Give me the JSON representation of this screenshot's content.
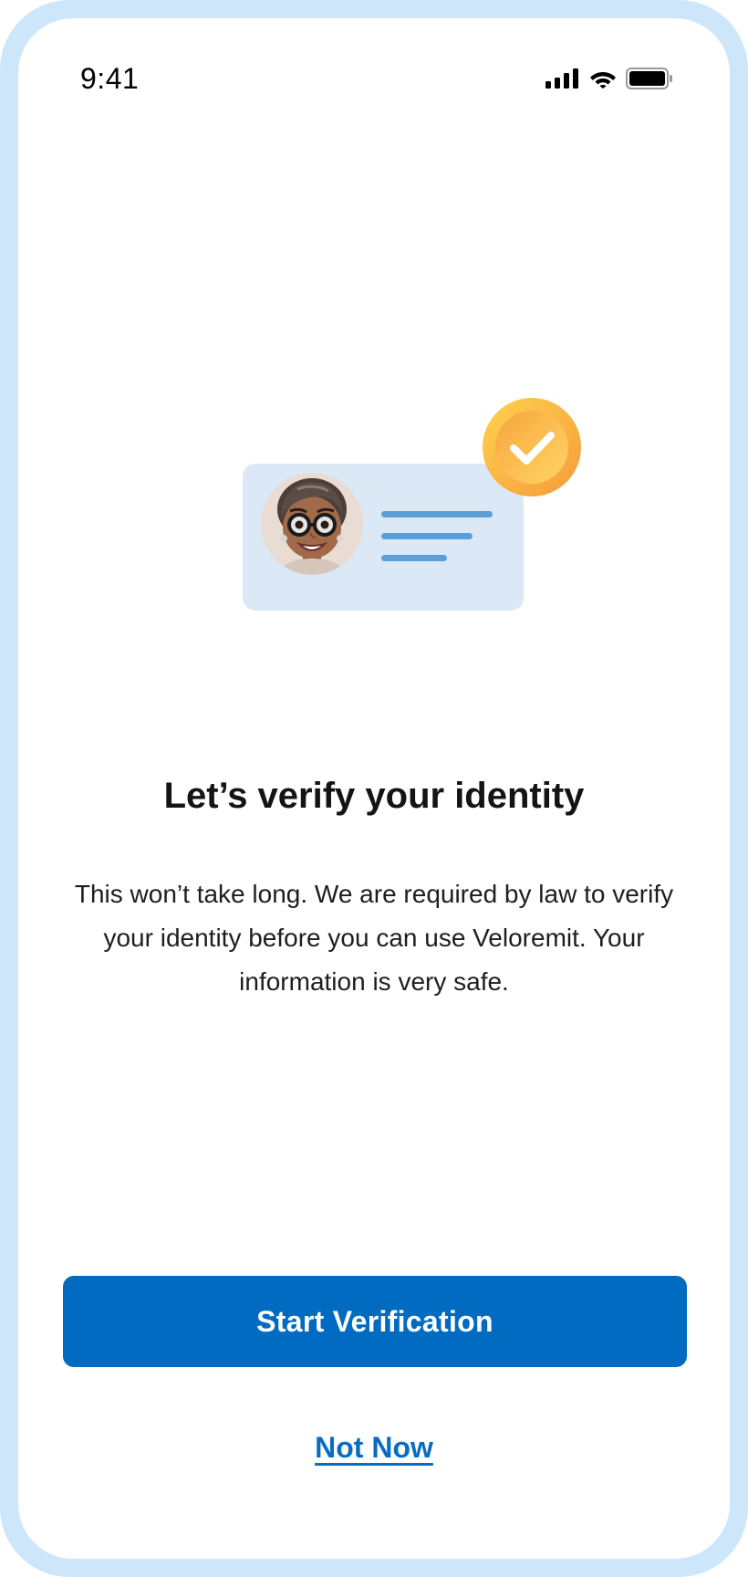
{
  "status_bar": {
    "time": "9:41",
    "icons": [
      "cellular-signal-icon",
      "wifi-icon",
      "battery-icon"
    ]
  },
  "illustration": {
    "elements": [
      "id-card-icon",
      "avatar",
      "checkmark-badge-icon"
    ]
  },
  "onboarding": {
    "title": "Let’s verify your identity",
    "description": "This won’t take long. We are required by law to verify your identity before you can use Veloremit. Your information is very safe."
  },
  "actions": {
    "primary_label": "Start Verification",
    "secondary_label": "Not Now"
  },
  "colors": {
    "frame": "#cde6fa",
    "primary": "#006bc1",
    "link": "#0a6cc0",
    "card": "#dbe8f5",
    "card_lines": "#5c9fd6",
    "badge": "#f9b84a"
  }
}
